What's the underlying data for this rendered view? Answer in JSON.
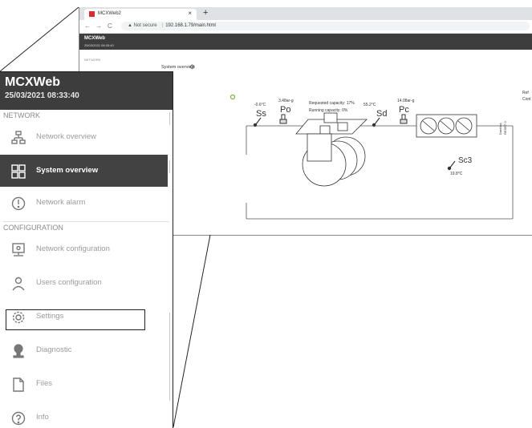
{
  "browser": {
    "tab_title": "MCXWeb2",
    "tab_close": "×",
    "new_tab": "+",
    "back": "←",
    "forward": "→",
    "reload": "C",
    "security_warning": "▲ Not secure",
    "separator": "|",
    "url": "192.168.1.79/main.html"
  },
  "app": {
    "title": "MCXWeb",
    "date": "25/03/2021 08:33:40",
    "network_label": "NETWORK"
  },
  "main": {
    "page_title": "System overview"
  },
  "diagram": {
    "ss_temp": "-0.6°C",
    "ss_label": "Ss",
    "po_pressure": "3.48ar-g",
    "po_label": "Po",
    "requested_capacity": "Requested capacity: 17%",
    "running_capacity": "Running capacity: 0%",
    "sd_temp": "55.2°C",
    "sd_label": "Sd",
    "pc_pressure": "14.08ar-g",
    "pc_label": "Pc",
    "sc3_label": "Sc3",
    "sc3_temp": "19.8°C",
    "side_text_1": "Ref",
    "side_text_2": "Cont",
    "vertical_text_1": "Danfoss",
    "vertical_text_2": "RESET 0"
  },
  "sidebar": {
    "title": "MCXWeb",
    "date": "25/03/2021 08:33:40",
    "section_network": "NETWORK",
    "section_configuration": "CONFIGURATION",
    "items": [
      {
        "label": "Network overview"
      },
      {
        "label": "System overview"
      },
      {
        "label": "Network alarm"
      },
      {
        "label": "Network configuration"
      },
      {
        "label": "Users configuration"
      },
      {
        "label": "Settings"
      },
      {
        "label": "Diagnostic"
      },
      {
        "label": "Files"
      },
      {
        "label": "Info"
      }
    ]
  },
  "colors": {
    "header_bg": "#3d3d3d",
    "active_item_bg": "#424242",
    "favicon": "#d32f2f",
    "status_dot": "#7cb342"
  }
}
